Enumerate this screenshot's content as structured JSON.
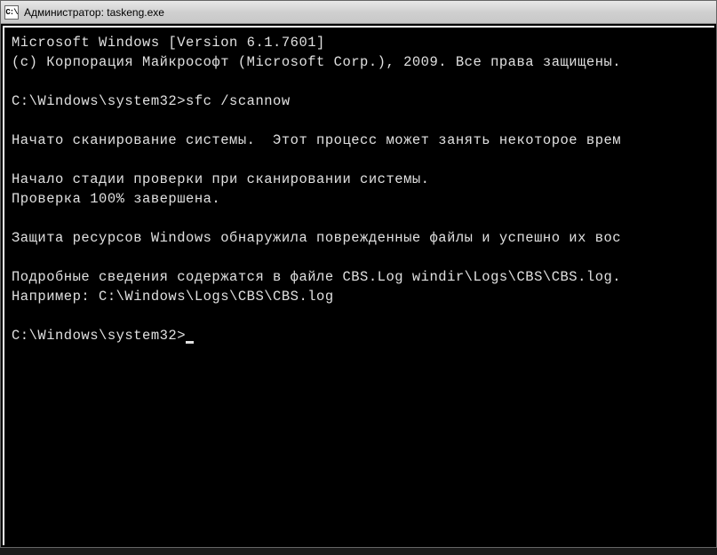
{
  "window": {
    "title": "Администратор: taskeng.exe",
    "icon_label": "C:\\"
  },
  "terminal": {
    "version_line": "Microsoft Windows [Version 6.1.7601]",
    "copyright_line": "(c) Корпорация Майкрософт (Microsoft Corp.), 2009. Все права защищены.",
    "prompt1": "C:\\Windows\\system32>",
    "command1": "sfc /scannow",
    "scan_started": "Начато сканирование системы.  Этот процесс может занять некоторое врем",
    "scan_stage": "Начало стадии проверки при сканировании системы.",
    "scan_progress": "Проверка 100% завершена.",
    "scan_result": "Защита ресурсов Windows обнаружила поврежденные файлы и успешно их вос",
    "details_line": "Подробные сведения содержатся в файле CBS.Log windir\\Logs\\CBS\\CBS.log.",
    "example_line": "Например: C:\\Windows\\Logs\\CBS\\CBS.log",
    "prompt2": "C:\\Windows\\system32>"
  }
}
